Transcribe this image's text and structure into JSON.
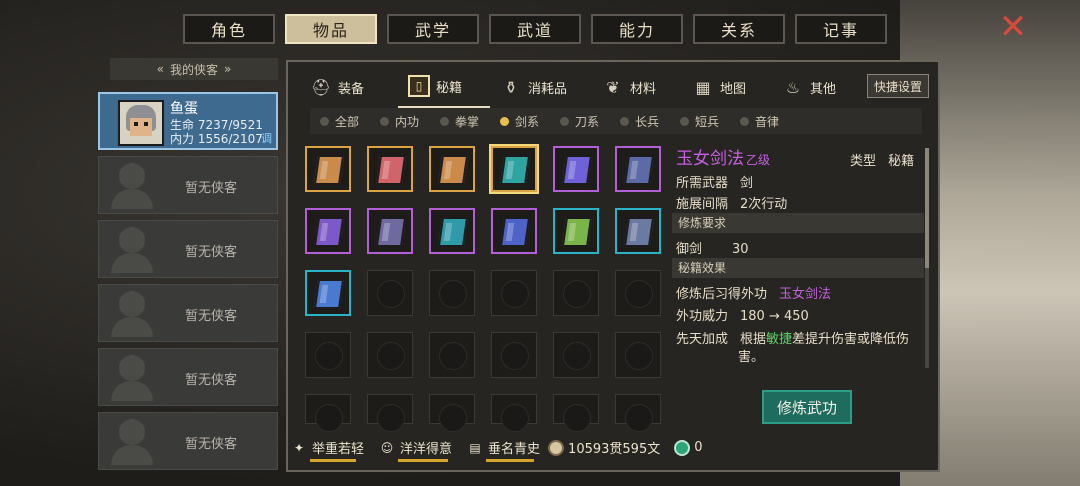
{
  "top_tabs": [
    "角色",
    "物品",
    "武学",
    "武道",
    "能力",
    "关系",
    "记事"
  ],
  "active_top_tab": 1,
  "left_panel": {
    "header": "我的侠客",
    "hero": {
      "name": "鱼蛋",
      "hp": "生命 7237/9521",
      "mp": "内力 1556/2107",
      "adjust": "调"
    },
    "empty_label": "暂无侠客"
  },
  "categories": [
    {
      "label": "装备",
      "icon": "armor-icon"
    },
    {
      "label": "秘籍",
      "icon": "book-icon"
    },
    {
      "label": "消耗品",
      "icon": "potion-icon"
    },
    {
      "label": "材料",
      "icon": "herb-icon"
    },
    {
      "label": "地图",
      "icon": "map-icon"
    },
    {
      "label": "其他",
      "icon": "lantern-icon"
    }
  ],
  "quick_settings": "快捷设置",
  "filters": [
    "全部",
    "内功",
    "拳掌",
    "剑系",
    "刀系",
    "长兵",
    "短兵",
    "音律"
  ],
  "active_filter": 3,
  "items": [
    {
      "color": "#c98a4a",
      "border": "#d9a441"
    },
    {
      "color": "#d0646a",
      "border": "#d9a441"
    },
    {
      "color": "#c98a4a",
      "border": "#d9a441"
    },
    {
      "color": "#2fa3a0",
      "border": "#d9a441"
    },
    {
      "color": "#6e62d6",
      "border": "#b35fd8"
    },
    {
      "color": "#5c6aa6",
      "border": "#b35fd8"
    },
    {
      "color": "#7d58c8",
      "border": "#b35fd8"
    },
    {
      "color": "#6e6aa0",
      "border": "#b35fd8"
    },
    {
      "color": "#2f9aa8",
      "border": "#b35fd8"
    },
    {
      "color": "#4d63c8",
      "border": "#b35fd8"
    },
    {
      "color": "#7ab54a",
      "border": "#2ab3c6"
    },
    {
      "color": "#6a7aa0",
      "border": "#2ab3c6"
    },
    {
      "color": "#4a7ad0",
      "border": "#2ab3c6"
    }
  ],
  "selected_item": 3,
  "detail": {
    "title": "玉女剑法",
    "grade": "乙级",
    "type_label": "类型",
    "type_value": "秘籍",
    "weapon_label": "所需武器",
    "weapon_value": "剑",
    "interval_label": "施展间隔",
    "interval_value": "2次行动",
    "req_header": "修炼要求",
    "req_label": "御剑",
    "req_value": "30",
    "effect_header": "秘籍效果",
    "learn_label": "修炼后习得外功",
    "learn_value": "玉女剑法",
    "power_label": "外功威力",
    "power_value": "180 → 450",
    "innate_label": "先天加成",
    "innate_pre": "根据",
    "innate_hl": "敏捷",
    "innate_post": "差提升伤害或降低伤",
    "innate_line2": "害。"
  },
  "train_button": "修炼武功",
  "status": {
    "weight": "举重若轻",
    "mood": "洋洋得意",
    "fame": "垂名青史",
    "money": "10593贯595文",
    "jade": "0"
  }
}
